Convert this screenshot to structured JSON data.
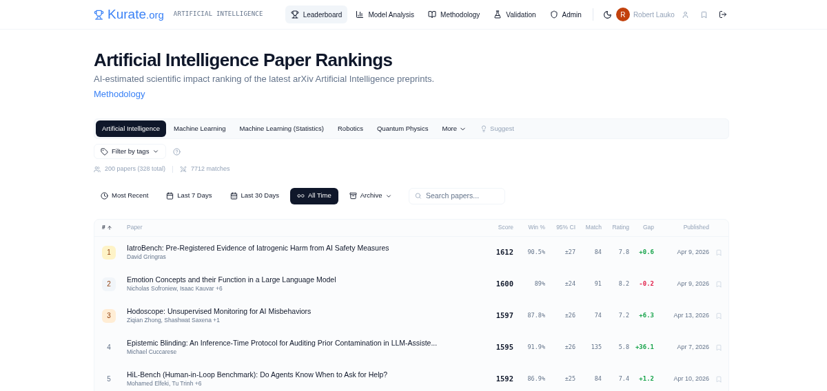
{
  "header": {
    "logo_main": "Kurate",
    "logo_suffix": ".org",
    "section": "ARTIFICIAL INTELLIGENCE",
    "nav": [
      {
        "label": "Leaderboard",
        "selected": true
      },
      {
        "label": "Model Analysis",
        "selected": false
      },
      {
        "label": "Methodology",
        "selected": false
      },
      {
        "label": "Validation",
        "selected": false
      },
      {
        "label": "Admin",
        "selected": false
      }
    ],
    "user": {
      "initial": "R",
      "name": "Robert Lauko"
    }
  },
  "title": "Artificial Intelligence Paper Rankings",
  "subtitle": "AI-estimated scientific impact ranking of the latest arXiv Artificial Intelligence preprints.",
  "methodology_link": "Methodology",
  "categories": [
    {
      "label": "Artificial Intelligence",
      "selected": true
    },
    {
      "label": "Machine Learning",
      "selected": false
    },
    {
      "label": "Machine Learning (Statistics)",
      "selected": false
    },
    {
      "label": "Robotics",
      "selected": false
    },
    {
      "label": "Quantum Physics",
      "selected": false
    }
  ],
  "more": "More",
  "suggest": "Suggest",
  "filter": "Filter by tags",
  "stats": {
    "papers": "200 papers (328 total)",
    "matches": "7712 matches"
  },
  "time_filters": [
    {
      "label": "Most Recent",
      "selected": false
    },
    {
      "label": "Last 7 Days",
      "selected": false
    },
    {
      "label": "Last 30 Days",
      "selected": false
    },
    {
      "label": "All Time",
      "selected": true
    }
  ],
  "archive": "Archive",
  "search": {
    "placeholder": "Search papers..."
  },
  "table": {
    "columns": [
      "#",
      "Paper",
      "Score",
      "Win %",
      "95% CI",
      "Match",
      "Rating",
      "Gap",
      "Published"
    ],
    "rows": [
      {
        "rank": "1",
        "color": "#fef3c7",
        "title": "IatroBench: Pre-Registered Evidence of Iatrogenic Harm from AI Safety Measures",
        "authors": "David Gringras",
        "score": "1612",
        "win": "90.5%",
        "ci": "±27",
        "match": "84",
        "rating": "7.8",
        "gap": {
          "text": "+0.6",
          "color": "#16a34a"
        },
        "published": "Apr 9, 2026"
      },
      {
        "rank": "2",
        "color": "#f1f5f9",
        "title": "Emotion Concepts and their Function in a Large Language Model",
        "authors": "Nicholas Sofroniew, Isaac Kauvar +6",
        "score": "1600",
        "win": "89%",
        "ci": "±24",
        "match": "91",
        "rating": "8.2",
        "gap": {
          "text": "-0.2",
          "color": "#e11d48"
        },
        "published": "Apr 9, 2026"
      },
      {
        "rank": "3",
        "color": "#ffedd5",
        "title": "Hodoscope: Unsupervised Monitoring for AI Misbehaviors",
        "authors": "Ziqian Zhong, Shashwat Saxena +1",
        "score": "1597",
        "win": "87.8%",
        "ci": "±26",
        "match": "74",
        "rating": "7.2",
        "gap": {
          "text": "+6.3",
          "color": "#16a34a"
        },
        "published": "Apr 13, 2026"
      },
      {
        "rank": "4",
        "title": "Epistemic Blinding: An Inference-Time Protocol for Auditing Prior Contamination in LLM-Assiste...",
        "authors": "Michael Cuccarese",
        "score": "1595",
        "win": "91.9%",
        "ci": "±26",
        "match": "135",
        "rating": "5.8",
        "gap": {
          "text": "+36.1",
          "color": "#16a34a"
        },
        "published": "Apr 7, 2026"
      },
      {
        "rank": "5",
        "title": "HiL-Bench (Human-in-Loop Benchmark): Do Agents Know When to Ask for Help?",
        "authors": "Mohamed Elfeki, Tu Trinh +6",
        "score": "1592",
        "win": "86.9%",
        "ci": "±25",
        "match": "84",
        "rating": "7.4",
        "gap": {
          "text": "+1.2",
          "color": "#16a34a"
        },
        "published": "Apr 10, 2026"
      }
    ]
  }
}
